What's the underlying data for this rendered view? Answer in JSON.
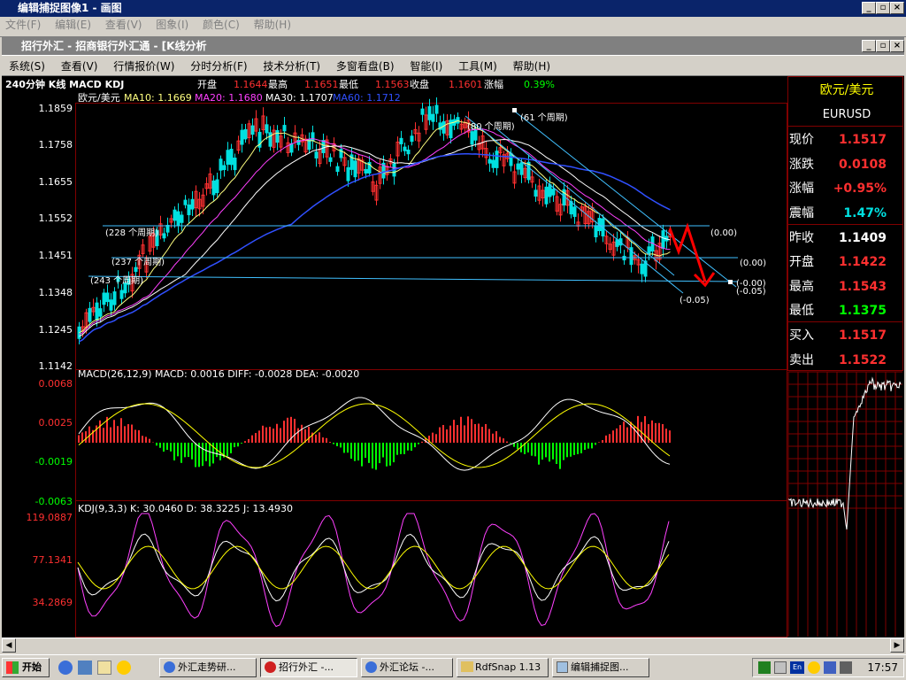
{
  "window": {
    "title": "编辑捕捉图像1 - 画图"
  },
  "outer_menu": [
    "文件(F)",
    "编辑(E)",
    "查看(V)",
    "图象(I)",
    "颜色(C)",
    "帮助(H)"
  ],
  "app": {
    "title": "招行外汇 - 招商银行外汇通 - [K线分析"
  },
  "app_menu": [
    "系统(S)",
    "查看(V)",
    "行情报价(W)",
    "分时分析(F)",
    "技术分析(T)",
    "多窗看盘(B)",
    "智能(I)",
    "工具(M)",
    "帮助(H)"
  ],
  "header": {
    "period": "240分钟 K线 MACD KDJ",
    "open_label": "开盘",
    "open_val": "1.1644",
    "high_label": "最高",
    "high_val": "1.1651",
    "low_label": "最低",
    "low_val": "1.1563",
    "close_label": "收盘",
    "close_val": "1.1601",
    "chg_label": "涨幅",
    "chg_val": "0.39%"
  },
  "ma_line": {
    "pair": "欧元/美元",
    "ma10": "MA10: 1.1669",
    "ma20": "MA20: 1.1680",
    "ma30": "MA30: 1.1707",
    "ma60": "MA60: 1.1712"
  },
  "price_axis": [
    "1.1859",
    "1.1758",
    "1.1655",
    "1.1552",
    "1.1451",
    "1.1348",
    "1.1245",
    "1.1142"
  ],
  "annotations": [
    "(80 个周期)",
    "(61 个周期)",
    "(228 个周期)",
    "(237 个周期)",
    "(243 个周期)",
    "(0.00)",
    "(0.00)",
    "(-0.00)",
    "(-0.05)",
    "(-0.05)"
  ],
  "macd": {
    "label": "MACD(26,12,9) MACD: 0.0016 DIFF: -0.0028 DEA: -0.0020",
    "axis": [
      "0.0068",
      "0.0025",
      "-0.0019",
      "-0.0063"
    ]
  },
  "kdj": {
    "label": "KDJ(9,3,3) K: 30.0460 D: 38.3225 J: 13.4930",
    "axis": [
      "119.0887",
      "77.1341",
      "34.2869"
    ]
  },
  "quote": {
    "pair": "欧元/美元",
    "code": "EURUSD",
    "rows": [
      {
        "label": "现价",
        "value": "1.1517"
      },
      {
        "label": "涨跌",
        "value": "0.0108"
      },
      {
        "label": "涨幅",
        "value": "+0.95%"
      },
      {
        "label": "震幅",
        "value": "1.47%"
      },
      {
        "label": "昨收",
        "value": "1.1409"
      },
      {
        "label": "开盘",
        "value": "1.1422"
      },
      {
        "label": "最高",
        "value": "1.1543"
      },
      {
        "label": "最低",
        "value": "1.1375"
      },
      {
        "label": "买入",
        "value": "1.1517"
      },
      {
        "label": "卖出",
        "value": "1.1522"
      }
    ]
  },
  "taskbar": {
    "start": "开始",
    "tasks": [
      "外汇走势研...",
      "招行外汇 -...",
      "外汇论坛 -...",
      "RdfSnap 1.13",
      "编辑捕捉图..."
    ],
    "clock": "17:57"
  },
  "colors": {
    "up": "#ff3030",
    "down": "#00e0e0",
    "ma10": "#ffff80",
    "ma20": "#ff40ff",
    "ma30": "#ffffff",
    "ma60": "#3050ff",
    "grid": "#800000"
  }
}
